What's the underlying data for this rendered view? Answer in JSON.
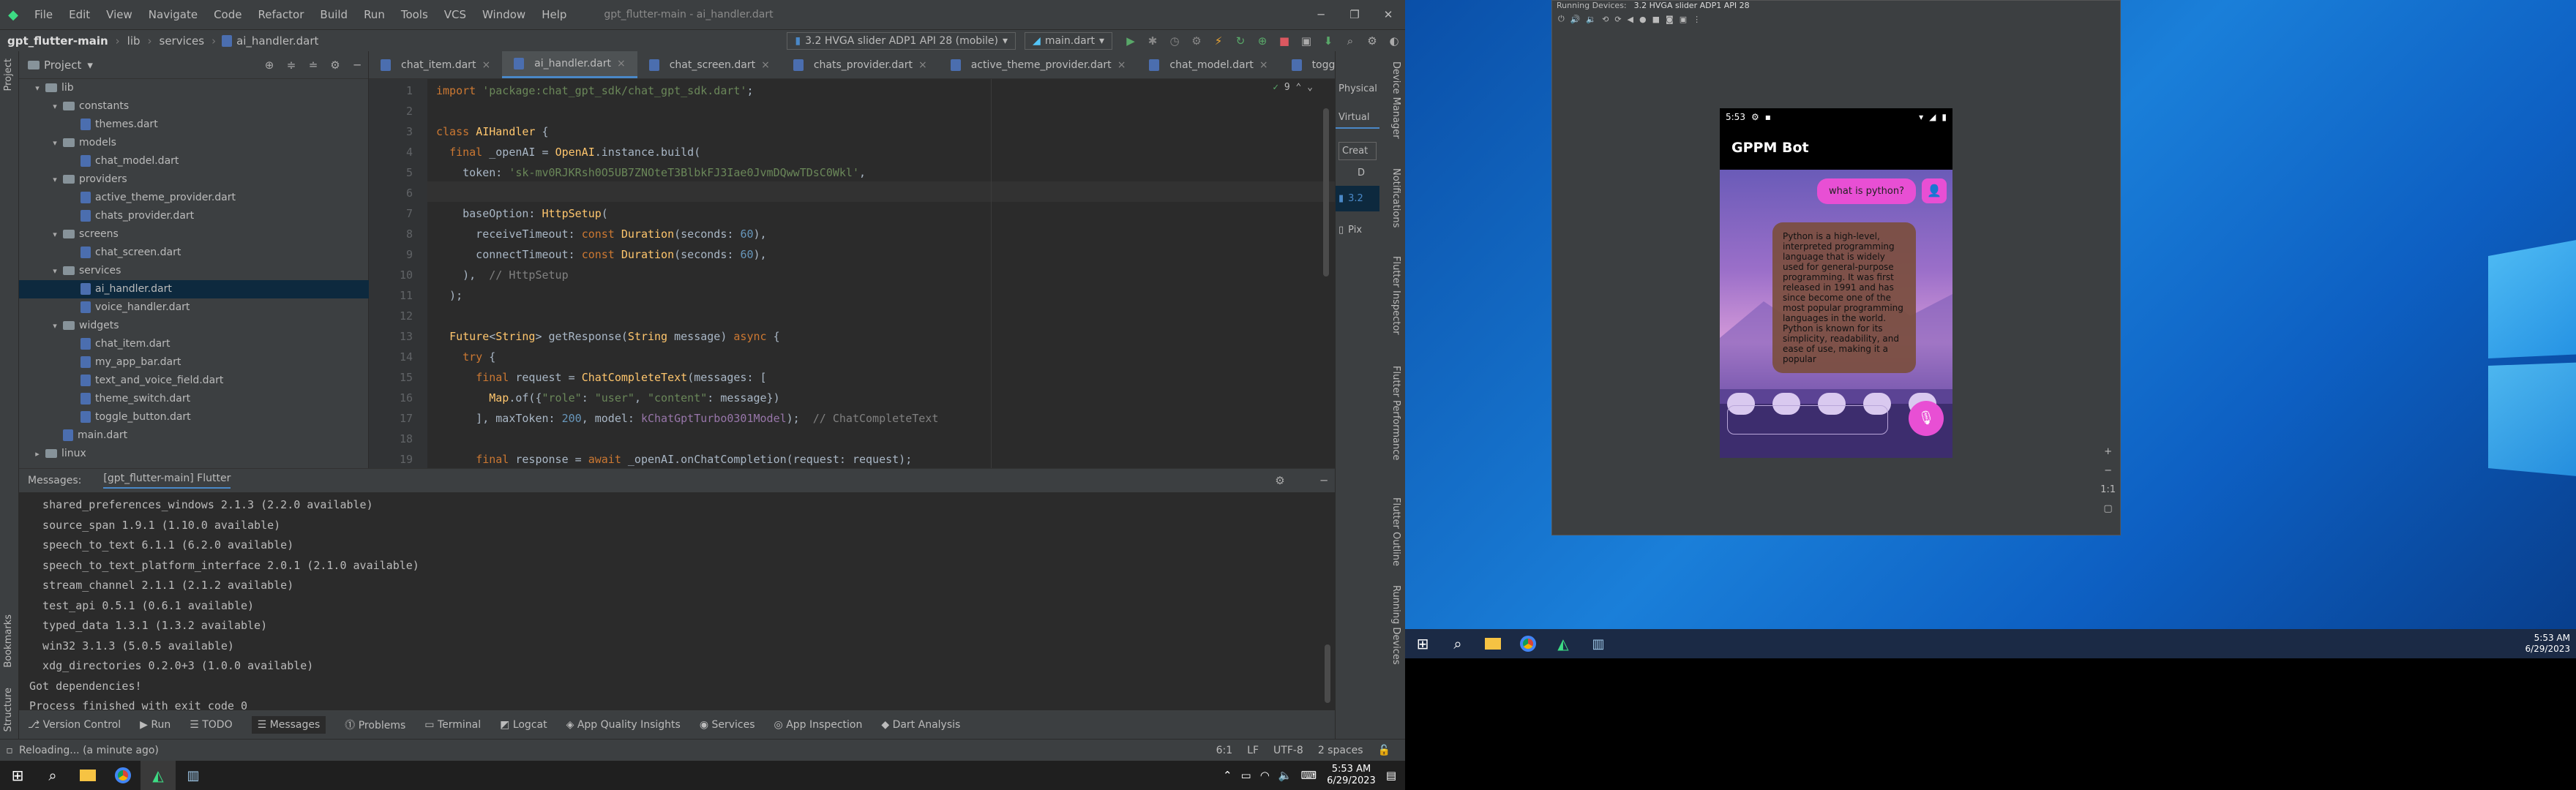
{
  "menu": [
    "File",
    "Edit",
    "View",
    "Navigate",
    "Code",
    "Refactor",
    "Build",
    "Run",
    "Tools",
    "VCS",
    "Window",
    "Help"
  ],
  "window_title": "gpt_flutter-main - ai_handler.dart",
  "breadcrumb": [
    "gpt_flutter-main",
    "lib",
    "services",
    "ai_handler.dart"
  ],
  "device_selector": "3.2 HVGA slider ADP1 API 28 (mobile)",
  "run_config": "main.dart",
  "project_panel": {
    "title": "Project"
  },
  "tree": [
    {
      "label": "lib",
      "type": "folder",
      "depth": 1,
      "open": true
    },
    {
      "label": "constants",
      "type": "folder",
      "depth": 2,
      "open": true
    },
    {
      "label": "themes.dart",
      "type": "file",
      "depth": 3
    },
    {
      "label": "models",
      "type": "folder",
      "depth": 2,
      "open": true
    },
    {
      "label": "chat_model.dart",
      "type": "file",
      "depth": 3
    },
    {
      "label": "providers",
      "type": "folder",
      "depth": 2,
      "open": true
    },
    {
      "label": "active_theme_provider.dart",
      "type": "file",
      "depth": 3
    },
    {
      "label": "chats_provider.dart",
      "type": "file",
      "depth": 3
    },
    {
      "label": "screens",
      "type": "folder",
      "depth": 2,
      "open": true
    },
    {
      "label": "chat_screen.dart",
      "type": "file",
      "depth": 3
    },
    {
      "label": "services",
      "type": "folder",
      "depth": 2,
      "open": true
    },
    {
      "label": "ai_handler.dart",
      "type": "file",
      "depth": 3,
      "selected": true
    },
    {
      "label": "voice_handler.dart",
      "type": "file",
      "depth": 3
    },
    {
      "label": "widgets",
      "type": "folder",
      "depth": 2,
      "open": true
    },
    {
      "label": "chat_item.dart",
      "type": "file",
      "depth": 3
    },
    {
      "label": "my_app_bar.dart",
      "type": "file",
      "depth": 3
    },
    {
      "label": "text_and_voice_field.dart",
      "type": "file",
      "depth": 3
    },
    {
      "label": "theme_switch.dart",
      "type": "file",
      "depth": 3
    },
    {
      "label": "toggle_button.dart",
      "type": "file",
      "depth": 3
    },
    {
      "label": "main.dart",
      "type": "file",
      "depth": 2
    },
    {
      "label": "linux",
      "type": "folder",
      "depth": 1,
      "open": false
    }
  ],
  "tabs": [
    {
      "label": "chat_item.dart",
      "active": false
    },
    {
      "label": "ai_handler.dart",
      "active": true
    },
    {
      "label": "chat_screen.dart",
      "active": false
    },
    {
      "label": "chats_provider.dart",
      "active": false
    },
    {
      "label": "active_theme_provider.dart",
      "active": false
    },
    {
      "label": "chat_model.dart",
      "active": false
    },
    {
      "label": "toggle_button.dart",
      "active": false
    }
  ],
  "editor": {
    "warning_count": "9",
    "lines": [
      {
        "n": "1",
        "text": "import 'package:chat_gpt_sdk/chat_gpt_sdk.dart';"
      },
      {
        "n": "2",
        "text": ""
      },
      {
        "n": "3",
        "text": "class AIHandler {"
      },
      {
        "n": "4",
        "text": "  final _openAI = OpenAI.instance.build("
      },
      {
        "n": "5",
        "text": "    token: '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',"
      },
      {
        "n": "6",
        "text": ""
      },
      {
        "n": "7",
        "text": "    baseOption: HttpSetup("
      },
      {
        "n": "8",
        "text": "      receiveTimeout: const Duration(seconds: 60),"
      },
      {
        "n": "9",
        "text": "      connectTimeout: const Duration(seconds: 60),"
      },
      {
        "n": "10",
        "text": "    ),  // HttpSetup"
      },
      {
        "n": "11",
        "text": "  );"
      },
      {
        "n": "12",
        "text": ""
      },
      {
        "n": "13",
        "text": "  Future<String> getResponse(String message) async {"
      },
      {
        "n": "14",
        "text": "    try {"
      },
      {
        "n": "15",
        "text": "      final request = ChatCompleteText(messages: ["
      },
      {
        "n": "16",
        "text": "        Map.of({\"role\": \"user\", \"content\": message})"
      },
      {
        "n": "17",
        "text": "      ], maxToken: 200, model: kChatGptTurbo0301Model);  // ChatCompleteText"
      },
      {
        "n": "18",
        "text": ""
      },
      {
        "n": "19",
        "text": "      final response = await _openAI.onChatCompletion(request: request);"
      }
    ]
  },
  "messages": {
    "title": "Messages:",
    "tab": "[gpt_flutter-main] Flutter",
    "lines": [
      "  shared_preferences_windows 2.1.3 (2.2.0 available)",
      "  source_span 1.9.1 (1.10.0 available)",
      "  speech_to_text 6.1.1 (6.2.0 available)",
      "  speech_to_text_platform_interface 2.0.1 (2.1.0 available)",
      "  stream_channel 2.1.1 (2.1.2 available)",
      "  test_api 0.5.1 (0.6.1 available)",
      "  typed_data 1.3.1 (1.3.2 available)",
      "  win32 3.1.3 (5.0.5 available)",
      "  xdg_directories 0.2.0+3 (1.0.0 available)",
      "Got dependencies!",
      "Process finished with exit code 0"
    ]
  },
  "bottom_tools": [
    "Version Control",
    "Run",
    "TODO",
    "Messages",
    "Problems",
    "Terminal",
    "Logcat",
    "App Quality Insights",
    "Services",
    "App Inspection",
    "Dart Analysis"
  ],
  "status": {
    "left": "Reloading... (a minute ago)",
    "pos": "6:1",
    "lf": "LF",
    "enc": "UTF-8",
    "indent": "2 spaces"
  },
  "left_strip": [
    "Project",
    "Bookmarks",
    "Structure"
  ],
  "right_strip": [
    "Device Manager",
    "Notifications",
    "Flutter Inspector",
    "Flutter Performance",
    "Flutter Outline",
    "Running Devices"
  ],
  "device_manager": {
    "tab1": "Physical",
    "tab2": "Virtual",
    "create": "Creat",
    "col": "D",
    "item1": "3.2",
    "item2": "Pix"
  },
  "clock": {
    "time": "5:53 AM",
    "date": "6/29/2023"
  },
  "emulator": {
    "header_label": "Running Devices:",
    "header_tab": "3.2 HVGA slider ADP1 API 28",
    "status_time": "5:53",
    "app_title": "GPPM Bot",
    "user_msg": "what is python?",
    "bot_msg": "Python is a high-level, interpreted programming language that is widely used for general-purpose programming. It was first released in 1991 and has since become one of the most popular programming languages in the world. Python is known for its simplicity, readability, and ease of use, making it a popular"
  },
  "colors": {
    "accent": "#4a88c7",
    "user_bubble": "#e84fd4",
    "bot_bubble": "#7b4e3e",
    "fab": "#e84fd4"
  }
}
